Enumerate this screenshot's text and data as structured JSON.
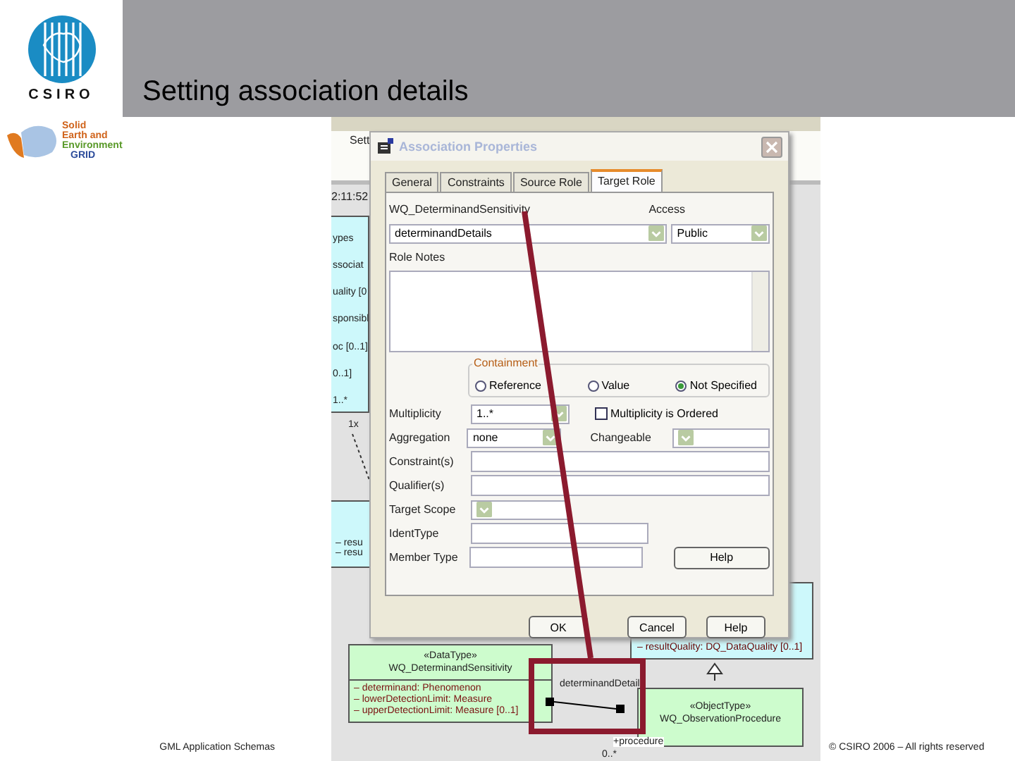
{
  "header": {
    "title": "Setting association details"
  },
  "logos": {
    "csiro": "CSIRO",
    "grid_lines": [
      "Solid",
      "Earth and",
      "Environment",
      "GRID"
    ]
  },
  "footer": {
    "left": "GML Application Schemas",
    "right": "© CSIRO 2006 – All rights reserved"
  },
  "screenshot": {
    "background": {
      "menu_text": "Sett",
      "time": "2:11:52",
      "left_panel_lines": [
        "ypes",
        "ssociat",
        "uality [0",
        "sponsibl",
        "oc [0..1]",
        "0..1]",
        "1..*"
      ],
      "multiplicity_label": "1x",
      "left_box_rows": [
        "– resu",
        "– resu"
      ],
      "result_box_rows": [
        "– resultQuality:  DQ_DataQuality [0..1]"
      ],
      "datatype_box": {
        "stereotype": "«DataType»",
        "name": "WQ_DeterminandSensitivity",
        "attributes": [
          "– determinand:  Phenomenon",
          "– lowerDetectionLimit:  Measure",
          "– upperDetectionLimit:  Measure [0..1]"
        ]
      },
      "objecttype_box": {
        "stereotype": "«ObjectType»",
        "name": "WQ_ObservationProcedure"
      },
      "role_label": "determinandDetail",
      "procedure_label": "+procedure",
      "procedure_multiplicity": "0..*"
    },
    "dialog": {
      "title": "Association Properties",
      "tabs": [
        {
          "label": "General",
          "selected": false
        },
        {
          "label": "Constraints",
          "selected": false
        },
        {
          "label": "Source Role",
          "selected": false
        },
        {
          "label": "Target Role",
          "selected": true
        }
      ],
      "class_label": "WQ_DeterminandSensitivity",
      "role_value": "determinandDetails",
      "access_label": "Access",
      "access_value": "Public",
      "notes_label": "Role Notes",
      "containment": {
        "legend": "Containment",
        "options": [
          {
            "label": "Reference",
            "selected": false
          },
          {
            "label": "Value",
            "selected": false
          },
          {
            "label": "Not Specified",
            "selected": true
          }
        ]
      },
      "multiplicity_label": "Multiplicity",
      "multiplicity_value": "1..*",
      "ordered": {
        "label": "Multiplicity is Ordered",
        "checked": false
      },
      "aggregation_label": "Aggregation",
      "aggregation_value": "none",
      "changeable_label": "Changeable",
      "constraints_label": "Constraint(s)",
      "qualifiers_label": "Qualifier(s)",
      "scope_label": "Target Scope",
      "ident_label": "IdentType",
      "member_label": "Member Type",
      "side_button": "Help",
      "buttons": [
        "OK",
        "Cancel",
        "Help"
      ]
    }
  }
}
